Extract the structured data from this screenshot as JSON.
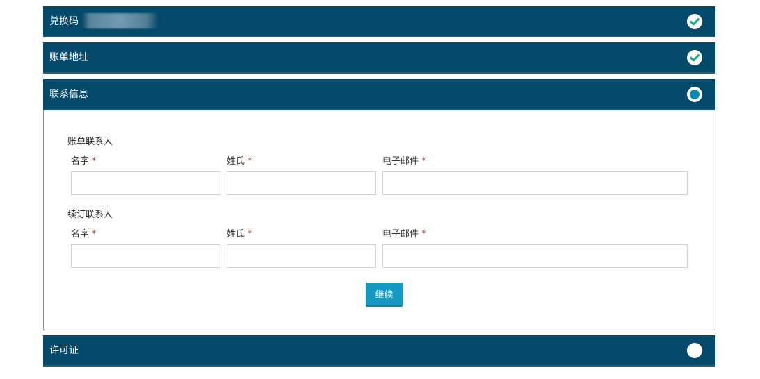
{
  "steps": [
    {
      "title": "兑换码",
      "status": "complete"
    },
    {
      "title": "账单地址",
      "status": "complete"
    },
    {
      "title": "联系信息",
      "status": "active"
    },
    {
      "title": "许可证",
      "status": "pending"
    }
  ],
  "contact": {
    "billing_title": "账单联系人",
    "renewal_title": "续订联系人",
    "first_name_label": "名字",
    "last_name_label": "姓氏",
    "email_label": "电子邮件",
    "required_marker": "*",
    "continue_label": "继续"
  },
  "colors": {
    "header_bg": "#03496a",
    "check_color": "#17a88b",
    "active_dot": "#0e86b8",
    "button_bg": "#1699c2",
    "required": "#c0392b"
  }
}
